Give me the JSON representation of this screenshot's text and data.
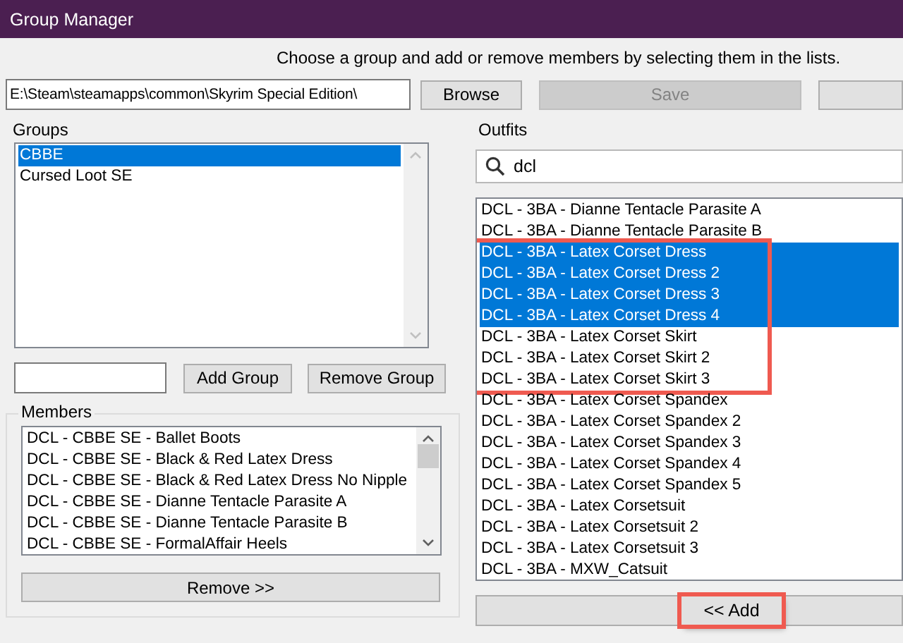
{
  "window": {
    "title": "Group Manager"
  },
  "instructions": "Choose a group and add or remove members by selecting them in the lists.",
  "path_field": {
    "value": "E:\\Steam\\steamapps\\common\\Skyrim Special Edition\\"
  },
  "top_buttons": [
    {
      "label": "Browse",
      "disabled": false
    },
    {
      "label": "Save",
      "disabled": true
    },
    {
      "disabled": false
    }
  ],
  "groups": {
    "title": "Groups",
    "items": [
      {
        "label": "CBBE",
        "selected": true
      },
      {
        "label": "Cursed Loot SE",
        "selected": false
      }
    ],
    "add_button": "Add Group",
    "remove_button": "Remove Group"
  },
  "members": {
    "title": "Members",
    "items": [
      {
        "label": "DCL - CBBE SE - Ballet Boots",
        "selected": false
      },
      {
        "label": "DCL - CBBE SE - Black & Red Latex Dress",
        "selected": false
      },
      {
        "label": "DCL - CBBE SE - Black & Red Latex Dress No Nipple",
        "selected": false
      },
      {
        "label": "DCL - CBBE SE - Dianne Tentacle Parasite A",
        "selected": false
      },
      {
        "label": "DCL - CBBE SE - Dianne Tentacle Parasite B",
        "selected": false
      },
      {
        "label": "DCL - CBBE SE - FormalAffair Heels",
        "selected": false
      }
    ],
    "remove_button": "Remove >>"
  },
  "outfits": {
    "title": "Outfits",
    "search": {
      "value": "dcl"
    },
    "items": [
      {
        "label": "DCL - 3BA - Dianne Tentacle Parasite A",
        "selected": false,
        "highlighted": false
      },
      {
        "label": "DCL - 3BA - Dianne Tentacle Parasite B",
        "selected": false,
        "highlighted": false
      },
      {
        "label": "DCL - 3BA - Latex Corset Dress",
        "selected": true,
        "highlighted": true
      },
      {
        "label": "DCL - 3BA - Latex Corset Dress 2",
        "selected": true,
        "highlighted": true
      },
      {
        "label": "DCL - 3BA - Latex Corset Dress 3",
        "selected": true,
        "highlighted": true
      },
      {
        "label": "DCL - 3BA - Latex Corset Dress 4",
        "selected": true,
        "highlighted": true
      },
      {
        "label": "DCL - 3BA - Latex Corset Skirt",
        "selected": false,
        "highlighted": true
      },
      {
        "label": "DCL - 3BA - Latex Corset Skirt 2",
        "selected": false,
        "highlighted": true
      },
      {
        "label": "DCL - 3BA - Latex Corset Skirt 3",
        "selected": false,
        "highlighted": true
      },
      {
        "label": "DCL - 3BA - Latex Corset Spandex",
        "selected": false,
        "highlighted": false
      },
      {
        "label": "DCL - 3BA - Latex Corset Spandex 2",
        "selected": false,
        "highlighted": false
      },
      {
        "label": "DCL - 3BA - Latex Corset Spandex 3",
        "selected": false,
        "highlighted": false
      },
      {
        "label": "DCL - 3BA - Latex Corset Spandex 4",
        "selected": false,
        "highlighted": false
      },
      {
        "label": "DCL - 3BA - Latex Corset Spandex 5",
        "selected": false,
        "highlighted": false
      },
      {
        "label": "DCL - 3BA - Latex Corsetsuit",
        "selected": false,
        "highlighted": false
      },
      {
        "label": "DCL - 3BA - Latex Corsetsuit 2",
        "selected": false,
        "highlighted": false
      },
      {
        "label": "DCL - 3BA - Latex Corsetsuit 3",
        "selected": false,
        "highlighted": false
      },
      {
        "label": "DCL - 3BA - MXW_Catsuit",
        "selected": false,
        "highlighted": false
      }
    ],
    "add_button": {
      "label": "<< Add",
      "highlighted": true
    }
  }
}
